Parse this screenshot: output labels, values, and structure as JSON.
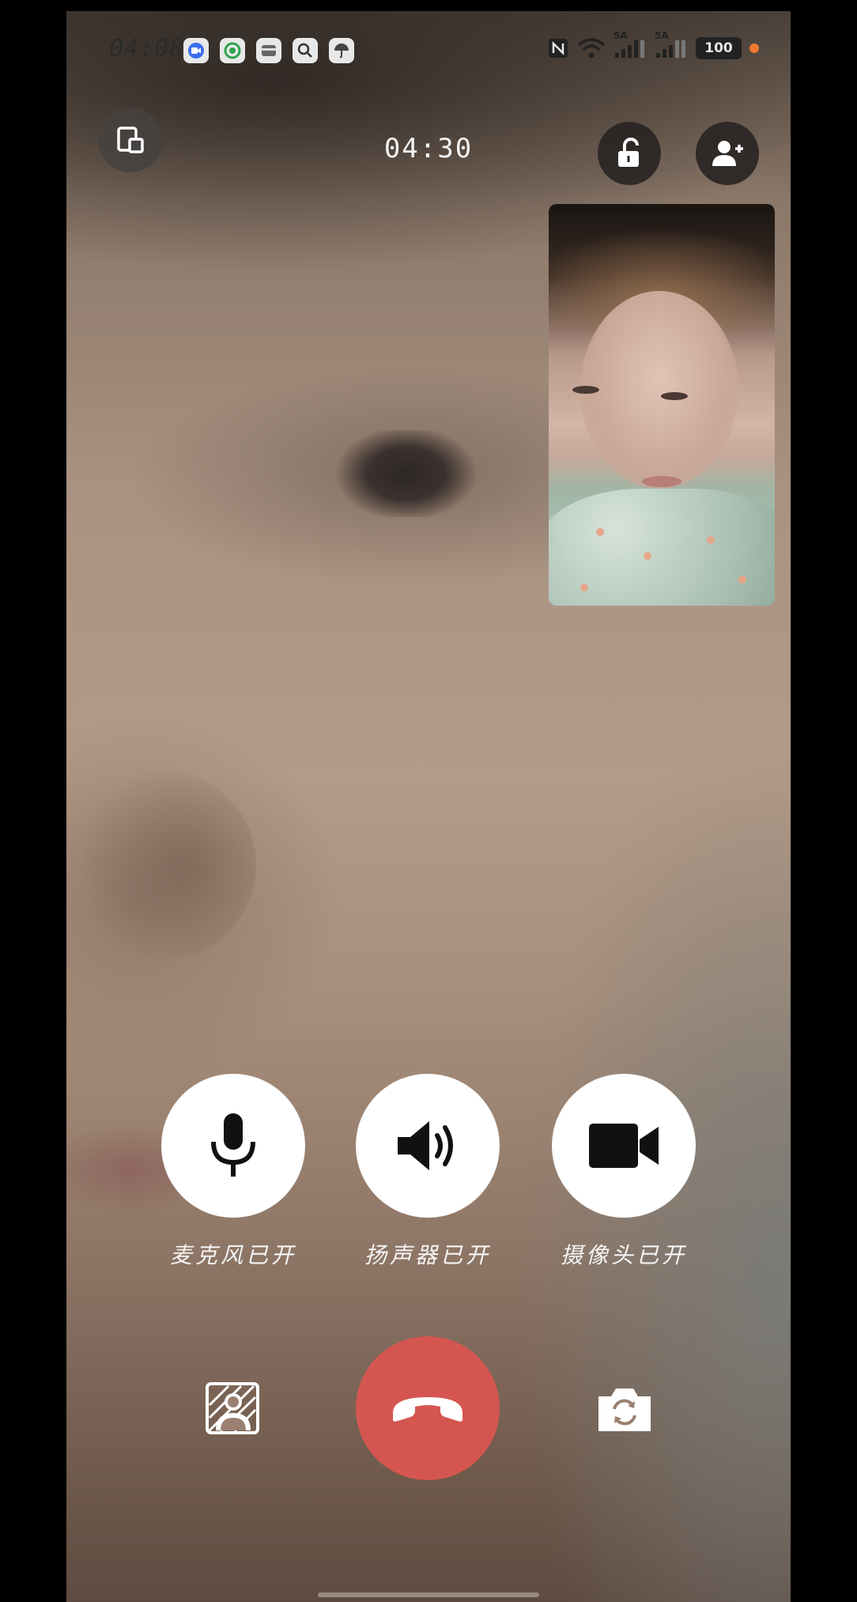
{
  "status_bar": {
    "time": "04:08",
    "network_labels": [
      "5A",
      "5A"
    ],
    "battery": "100"
  },
  "call": {
    "duration": "04:30"
  },
  "controls": {
    "microphone_label": "麦克风已开",
    "speaker_label": "扬声器已开",
    "camera_label": "摄像头已开"
  },
  "icons": {
    "minimize": "minimize-window-icon",
    "lock": "unlock-icon",
    "add_member": "add-person-icon",
    "microphone": "microphone-icon",
    "speaker": "speaker-icon",
    "camera": "video-camera-icon",
    "background": "blur-background-icon",
    "hangup": "hang-up-icon",
    "switch_camera": "switch-camera-icon"
  },
  "colors": {
    "hangup": "#d55651",
    "control_bg": "#ffffff",
    "top_button_bg": "#46423f",
    "record_dot": "#f07a30"
  }
}
